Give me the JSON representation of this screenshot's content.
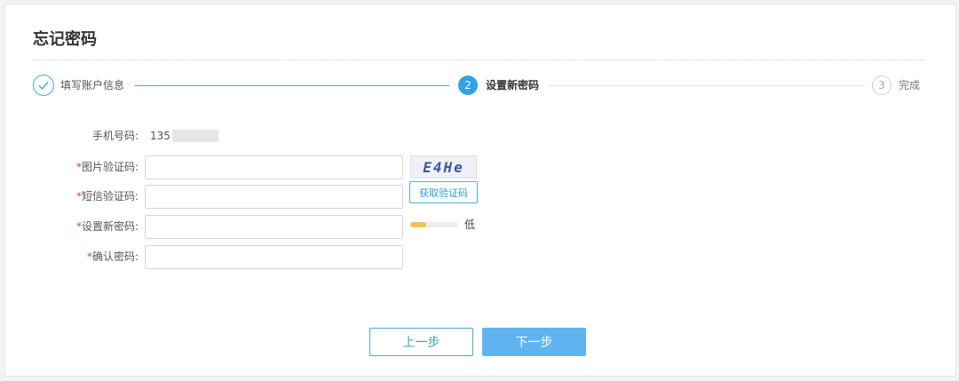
{
  "page": {
    "title": "忘记密码"
  },
  "steps": [
    {
      "number": "✓",
      "label": "填写账户信息",
      "state": "done"
    },
    {
      "number": "2",
      "label": "设置新密码",
      "state": "active"
    },
    {
      "number": "3",
      "label": "完成",
      "state": "todo"
    }
  ],
  "form": {
    "phone": {
      "label": "手机号码:",
      "value": "135"
    },
    "captcha": {
      "required": "*",
      "label": "图片验证码:",
      "value": "",
      "captcha_text": "E4He"
    },
    "sms": {
      "required": "*",
      "label": "短信验证码:",
      "value": "",
      "button_label": "获取验证码"
    },
    "new_password": {
      "required": "*",
      "label": "设置新密码:",
      "value": "",
      "strength_label": "低",
      "strength_level": 0.33
    },
    "confirm_password": {
      "required": "*",
      "label": "确认密码:",
      "value": ""
    }
  },
  "actions": {
    "prev_label": "上一步",
    "next_label": "下一步"
  },
  "colors": {
    "accent": "#2ea3e7",
    "primary_button": "#5fb4f0",
    "required": "#e4393c",
    "strength_low": "#f3c14b"
  }
}
